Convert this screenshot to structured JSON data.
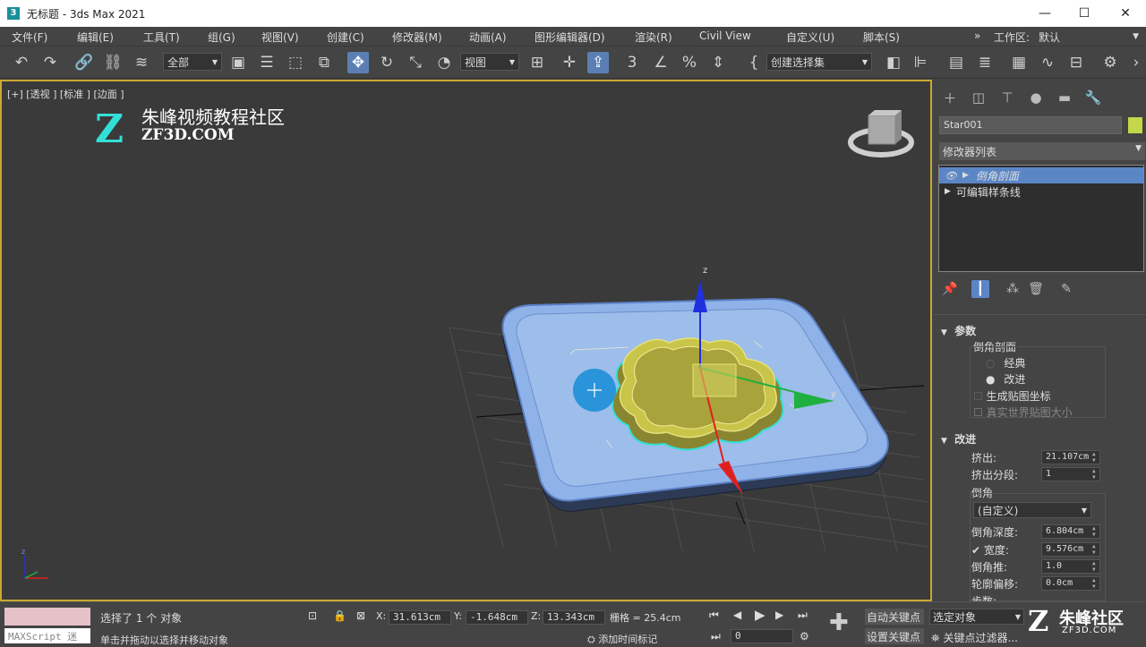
{
  "window": {
    "title": "无标题 - 3ds Max 2021",
    "app_icon": "3",
    "minimize": "—",
    "maximize": "☐",
    "close": "✕"
  },
  "menu": {
    "items": [
      "文件(F)",
      "编辑(E)",
      "工具(T)",
      "组(G)",
      "视图(V)",
      "创建(C)",
      "修改器(M)",
      "动画(A)",
      "图形编辑器(D)",
      "渲染(R)",
      "Civil View",
      "自定义(U)",
      "脚本(S)"
    ],
    "more": "»",
    "workspace_label": "工作区:",
    "workspace_value": "默认"
  },
  "toolbar": {
    "selection_filter": "全部",
    "reference_coord": "视图",
    "named_selection": "创建选择集",
    "icons": [
      "undo-icon",
      "redo-icon",
      "link-icon",
      "unlink-icon",
      "bind-spacewarp-icon",
      "select-object-icon",
      "select-by-name-icon",
      "rect-region-icon",
      "window-crossing-icon",
      "select-move-icon",
      "select-rotate-icon",
      "select-scale-icon",
      "placement-icon",
      "pivot-icon",
      "manipulate-icon",
      "keyboard-shortcut-icon",
      "snap-3d-icon",
      "angle-snap-icon",
      "percent-snap-icon",
      "spinner-snap-icon",
      "edit-named-selection-icon",
      "mirror-icon",
      "align-icon",
      "layer-explorer-icon",
      "scene-explorer-icon",
      "toggle-ribbon-icon",
      "schematic-view-icon",
      "material-editor-icon",
      "curve-editor-icon",
      "render-setup-icon",
      "render-frame-icon"
    ]
  },
  "viewport": {
    "label": "[+] [透视 ] [标准 ] [边面 ]",
    "watermark_cn": "朱峰视频教程社区",
    "watermark_en": "ZF3D.COM",
    "watermark_z": "Z",
    "gizmo_axis_labels": {
      "x": "x",
      "y": "y",
      "z": "z"
    },
    "colors": {
      "background": "#3a3a3a",
      "border": "#c8a830",
      "base_plate": "#8fb3e8",
      "star": "#c9c44a",
      "x_axis": "#e02020",
      "y_axis": "#20b040",
      "z_axis": "#2030e0"
    }
  },
  "command_panel": {
    "tab_icons": [
      "create-tab-icon",
      "modify-tab-icon",
      "hierarchy-tab-icon",
      "motion-tab-icon",
      "display-tab-icon",
      "utilities-tab-icon"
    ],
    "object_name": "Star001",
    "object_color": "#c4d64a",
    "modifier_list_label": "修改器列表",
    "stack": [
      {
        "label": "倒角剖面",
        "selected": true
      },
      {
        "label": "可编辑样条线",
        "selected": false
      }
    ],
    "params_title": "参数",
    "bevel_profile_label": "倒角剖面",
    "option_classic": "经典",
    "option_improved": "改进",
    "gen_map_coords": "生成贴图坐标",
    "real_world_map": "真实世界贴图大小",
    "improved_title": "改进",
    "extrude_label": "挤出:",
    "extrude_value": "21.107cm",
    "extrude_segments_label": "挤出分段:",
    "extrude_segments_value": "1",
    "bevel_label": "倒角",
    "bevel_preset": "(自定义)",
    "bevel_depth_label": "倒角深度:",
    "bevel_depth_value": "6.804cm",
    "width_label": "宽度:",
    "width_value": "9.576cm",
    "bevel_push_label": "倒角推:",
    "bevel_push_value": "1.0",
    "contour_offset_label": "轮廓偏移:",
    "contour_offset_value": "0.0cm",
    "steps_label": "步数:"
  },
  "status": {
    "selection_text": "选择了 1 个 对象",
    "prompt_text": "单击并拖动以选择并移动对象",
    "maxscript_label": "MAXScript 迷",
    "x_label": "X:",
    "x_value": "31.613cm",
    "y_label": "Y:",
    "y_value": "-1.648cm",
    "z_label": "Z:",
    "z_value": "13.343cm",
    "grid_text": "栅格 = 25.4cm",
    "add_time_tag": "添加时间标记",
    "frame_value": "0",
    "auto_key": "自动关键点",
    "set_key": "设置关键点",
    "selected_objects": "选定对象",
    "key_filters": "关键点过滤器...",
    "watermark_cn": "朱峰社区",
    "watermark_en": "ZF3D.COM",
    "watermark_z": "Z"
  }
}
